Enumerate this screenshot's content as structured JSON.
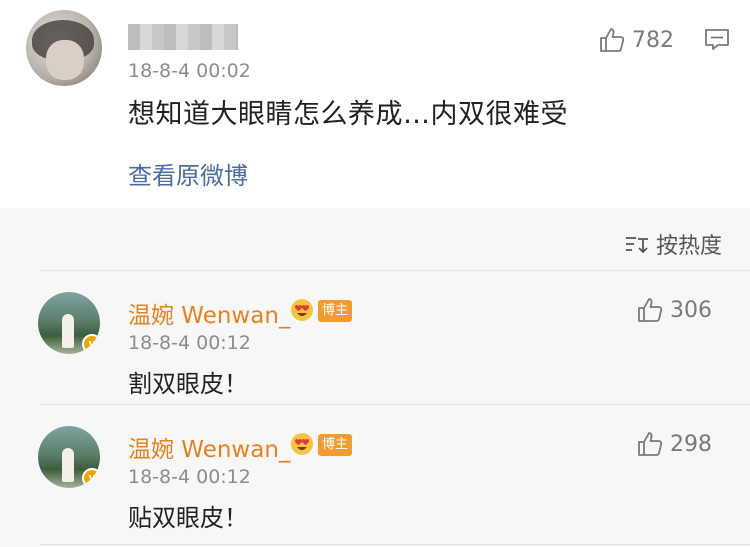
{
  "post": {
    "time": "18-8-4 00:02",
    "content": "想知道大眼睛怎么养成…内双很难受",
    "view_original": "查看原微博",
    "like_count": "782"
  },
  "comments_header": {
    "sort_label": "按热度"
  },
  "comments": [
    {
      "username": "温婉 Wenwan_",
      "badge_label": "博主",
      "time": "18-8-4 00:12",
      "content": "割双眼皮！",
      "like_count": "306"
    },
    {
      "username": "温婉 Wenwan_",
      "badge_label": "博主",
      "time": "18-8-4 00:12",
      "content": "贴双眼皮！",
      "like_count": "298"
    }
  ],
  "colors": {
    "username": "#e4821f",
    "link": "#4b6c9c",
    "badge": "#f29b30",
    "meta": "#8c8c8c"
  }
}
